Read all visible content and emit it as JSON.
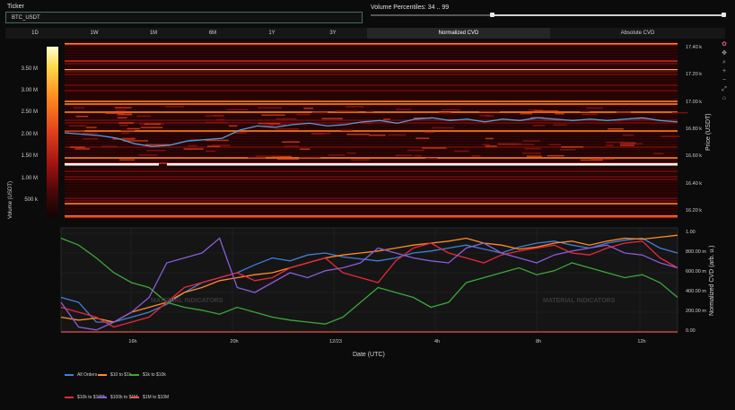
{
  "ticker": {
    "label": "Ticker",
    "value": "BTC_USDT"
  },
  "volume_percentiles": {
    "label": "Volume Percentiles: 34 .. 99",
    "low": 34,
    "high": 99
  },
  "tabs": [
    {
      "label": "1D",
      "active": false
    },
    {
      "label": "1W",
      "active": false
    },
    {
      "label": "1M",
      "active": false
    },
    {
      "label": "6M",
      "active": false
    },
    {
      "label": "1Y",
      "active": false
    },
    {
      "label": "3Y",
      "active": false
    },
    {
      "label": "Normalized CVD",
      "active": true
    },
    {
      "label": "Absolute CVD",
      "active": false
    }
  ],
  "colorbar": {
    "title": "Volume (USDT)",
    "ticks": [
      "3.50 M",
      "3.00 M",
      "2.50 M",
      "2.00 M",
      "1.50 M",
      "1.00 M",
      "500 k"
    ]
  },
  "watermark": "MATERIAL INDICATORS",
  "chart_data": [
    {
      "type": "heatmap",
      "ylabel": "Price (USDT)",
      "yticks": [
        "17.40 k",
        "17.20 k",
        "17.00 k",
        "16.80 k",
        "16.60 k",
        "16.40 k",
        "16.20 k"
      ],
      "ylim": [
        16150,
        17450
      ],
      "price_line": [
        16780,
        16770,
        16760,
        16740,
        16700,
        16680,
        16690,
        16720,
        16730,
        16740,
        16800,
        16830,
        16820,
        16840,
        16850,
        16830,
        16840,
        16860,
        16870,
        16850,
        16880,
        16890,
        16870,
        16880,
        16860,
        16880,
        16870,
        16890,
        16880,
        16870,
        16880,
        16870,
        16880,
        16890,
        16870,
        16860
      ]
    },
    {
      "type": "line",
      "xlabel": "Date (UTC)",
      "ylabel": "Normalized CVD (arb. u.)",
      "xticks": [
        "16h",
        "20h",
        "12/23",
        "4h",
        "8h",
        "12h"
      ],
      "yticks": [
        "0.00",
        "200.00 m",
        "400.00 m",
        "600.00 m",
        "800.00 m",
        "1.00"
      ],
      "ylim": [
        0,
        1
      ],
      "series": [
        {
          "name": "All Orders",
          "color": "#3f7fd6",
          "values": [
            0.35,
            0.3,
            0.1,
            0.1,
            0.15,
            0.2,
            0.28,
            0.4,
            0.5,
            0.55,
            0.6,
            0.68,
            0.75,
            0.72,
            0.78,
            0.8,
            0.76,
            0.74,
            0.72,
            0.75,
            0.8,
            0.82,
            0.85,
            0.88,
            0.84,
            0.8,
            0.86,
            0.9,
            0.92,
            0.88,
            0.85,
            0.9,
            0.93,
            0.95,
            0.85,
            0.8
          ]
        },
        {
          "name": "$10 to $1k",
          "color": "#ff8c28",
          "values": [
            0.15,
            0.12,
            0.14,
            0.1,
            0.2,
            0.25,
            0.3,
            0.4,
            0.45,
            0.52,
            0.55,
            0.58,
            0.6,
            0.65,
            0.7,
            0.75,
            0.78,
            0.8,
            0.82,
            0.85,
            0.88,
            0.9,
            0.92,
            0.95,
            0.9,
            0.88,
            0.84,
            0.86,
            0.9,
            0.92,
            0.88,
            0.92,
            0.95,
            0.94,
            0.96,
            0.98
          ]
        },
        {
          "name": "$1k to $10k",
          "color": "#3aa83a",
          "values": [
            0.95,
            0.88,
            0.75,
            0.6,
            0.5,
            0.45,
            0.3,
            0.25,
            0.22,
            0.18,
            0.25,
            0.2,
            0.15,
            0.12,
            0.1,
            0.08,
            0.15,
            0.3,
            0.45,
            0.4,
            0.35,
            0.25,
            0.3,
            0.5,
            0.55,
            0.6,
            0.65,
            0.58,
            0.62,
            0.7,
            0.65,
            0.6,
            0.55,
            0.58,
            0.5,
            0.35
          ]
        },
        {
          "name": "$10k to $100k",
          "color": "#e8283c",
          "values": [
            0.25,
            0.2,
            0.15,
            0.05,
            0.1,
            0.15,
            0.3,
            0.45,
            0.5,
            0.55,
            0.6,
            0.52,
            0.55,
            0.65,
            0.7,
            0.75,
            0.6,
            0.55,
            0.5,
            0.72,
            0.85,
            0.9,
            0.8,
            0.75,
            0.7,
            0.78,
            0.82,
            0.85,
            0.88,
            0.8,
            0.78,
            0.85,
            0.9,
            0.92,
            0.75,
            0.65
          ]
        },
        {
          "name": "$100k to $1M",
          "color": "#8a5cd8",
          "values": [
            0.3,
            0.05,
            0.02,
            0.1,
            0.2,
            0.35,
            0.7,
            0.75,
            0.8,
            0.95,
            0.45,
            0.4,
            0.5,
            0.6,
            0.55,
            0.62,
            0.65,
            0.7,
            0.85,
            0.8,
            0.75,
            0.72,
            0.7,
            0.85,
            0.9,
            0.8,
            0.75,
            0.7,
            0.78,
            0.82,
            0.85,
            0.88,
            0.8,
            0.78,
            0.7,
            0.65
          ]
        },
        {
          "name": "$1M to $10M",
          "color": "#e05a4a",
          "values": [
            0.0,
            0.0,
            0.0,
            0.0,
            0.0,
            0.0,
            0.0,
            0.0,
            0.0,
            0.0,
            0.0,
            0.0,
            0.0,
            0.0,
            0.0,
            0.0,
            0.0,
            0.0,
            0.0,
            0.0,
            0.0,
            0.0,
            0.0,
            0.0,
            0.0,
            0.0,
            0.0,
            0.0,
            0.0,
            0.0,
            0.0,
            0.0,
            0.0,
            0.0,
            0.0,
            0.0
          ]
        }
      ]
    }
  ]
}
